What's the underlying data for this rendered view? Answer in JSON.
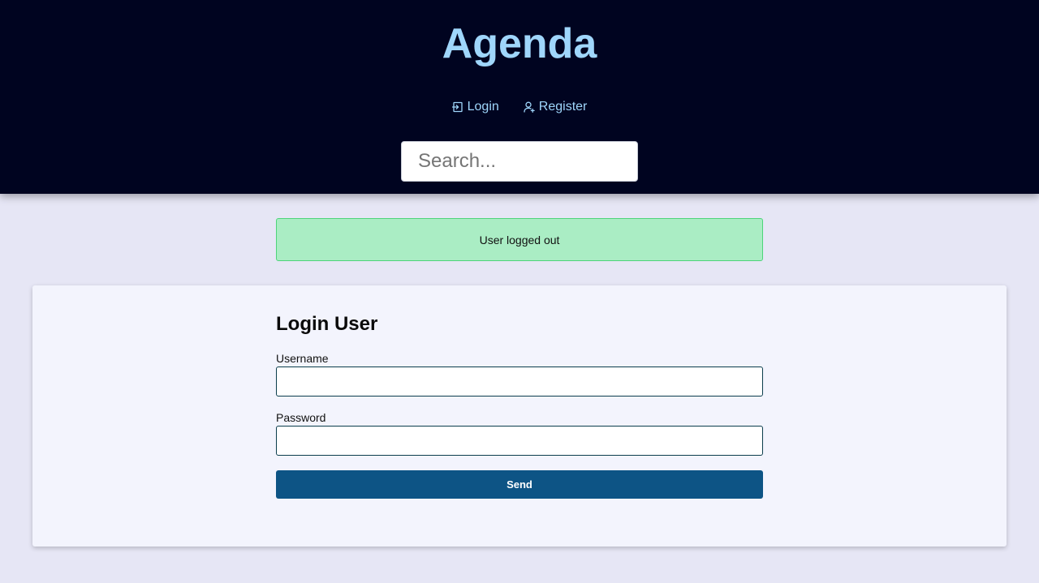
{
  "header": {
    "brand": "Agenda",
    "nav": [
      {
        "label": "Login",
        "icon": "login-icon"
      },
      {
        "label": "Register",
        "icon": "user-plus-icon"
      }
    ],
    "search": {
      "placeholder": "Search...",
      "value": ""
    }
  },
  "alert": {
    "message": "User logged out"
  },
  "login_form": {
    "title": "Login User",
    "username_label": "Username",
    "username_value": "",
    "password_label": "Password",
    "password_value": "",
    "submit_label": "Send"
  },
  "colors": {
    "header_bg": "#000420",
    "brand": "#9fd6fb",
    "page_bg": "#e6e6f5",
    "alert_bg": "#aaedc4",
    "alert_border": "#4ed47a",
    "button_bg": "#0d5485"
  }
}
